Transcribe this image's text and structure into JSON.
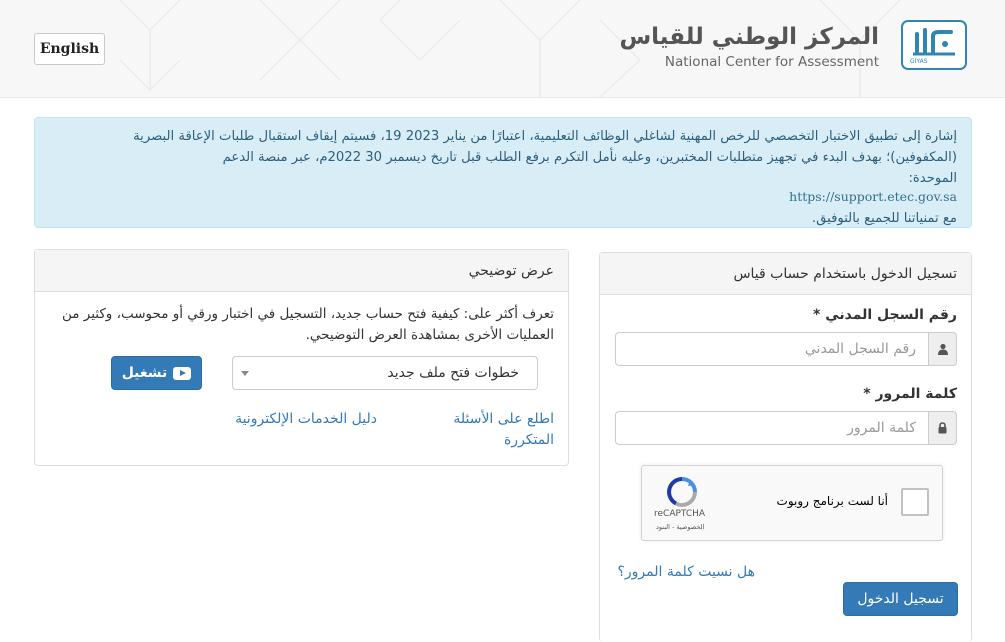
{
  "header": {
    "language_button": "English",
    "logo_ar": "المركز الوطني للقياس",
    "logo_en": "National Center for Assessment",
    "logo_mark_text": "GIYAS"
  },
  "notice": {
    "line1": "إشارة إلى تطبيق الاختبار التخصصي للرخص المهنية لشاغلي الوظائف التعليمية، اعتبارًا من يناير 2023 19، فسيتم إيقاف استقبال طلبات الإعاقة البصرية",
    "line2": "(المكفوفين)؛ بهدف البدء في تجهيز متطلبات المختبرين، وعليه نأمل التكرم برفع الطلب قبل تاريخ ديسمبر 30 2022م، عبر منصة الدعم",
    "line3": "الموحدة:",
    "url": "https://support.etec.gov.sa",
    "line4": "مع تمنياتنا للجميع بالتوفيق."
  },
  "demo": {
    "title": "عرض توضيحي",
    "description": "تعرف أكثر على: كيفية فتح حساب جديد، التسجيل في اختبار ورقي أو محوسب، وكثير من العمليات الأخرى بمشاهدة العرض التوضيحي.",
    "select_value": "خطوات فتح ملف جديد",
    "play_button": "تشغيل",
    "faq_link": "اطلع على الأسئلة المتكررة",
    "guide_link": "دليل الخدمات الإلكترونية"
  },
  "login": {
    "title": "تسجيل الدخول باستخدام حساب قياس",
    "id_label": "رقم السجل المدني *",
    "id_placeholder": "رقم السجل المدني",
    "password_label": "كلمة المرور *",
    "password_placeholder": "كلمة المرور",
    "captcha_text": "أنا لست برنامج روبوت",
    "captcha_brand": "reCAPTCHA",
    "captcha_terms": "الخصوصية - البنود",
    "forgot_link": "هل نسيت كلمة المرور؟",
    "submit_button": "تسجيل الدخول"
  },
  "colors": {
    "primary": "#337ab7",
    "notice_bg": "#d9edf7",
    "logo_blue": "#2e86b4"
  }
}
